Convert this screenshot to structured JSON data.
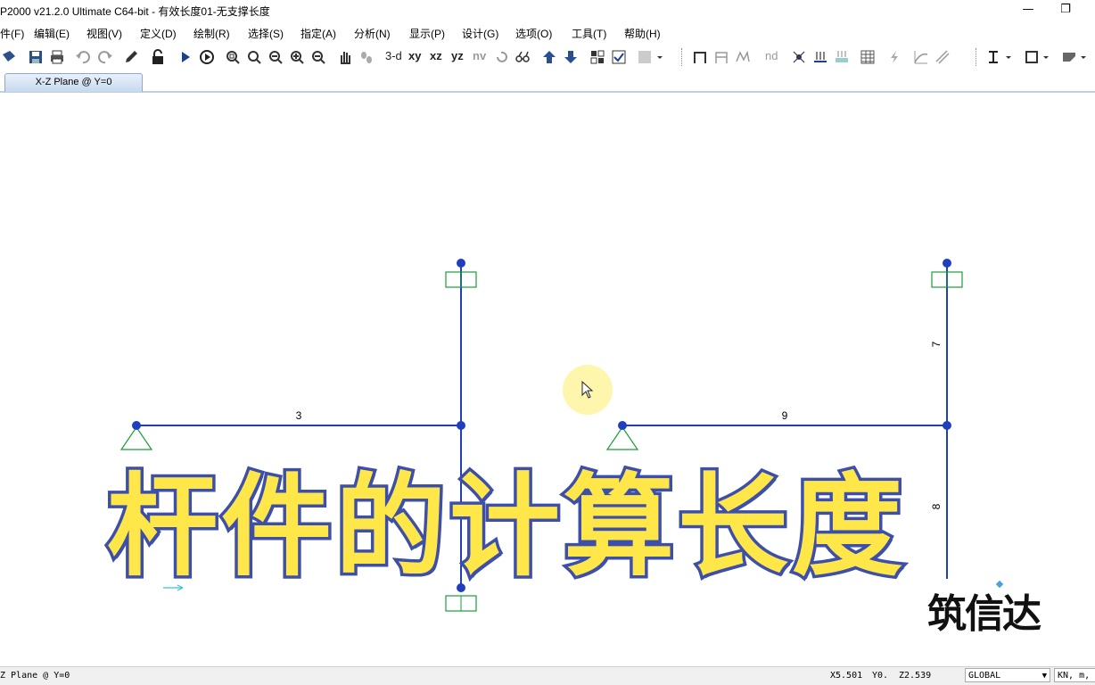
{
  "window": {
    "title": "P2000 v21.2.0 Ultimate C64-bit - 有效长度01-无支撑长度",
    "minimize_glyph": "—",
    "restore_glyph": "❐"
  },
  "menu": {
    "items": [
      {
        "label": "件(F)"
      },
      {
        "label": "编辑(E)"
      },
      {
        "label": "视图(V)"
      },
      {
        "label": "定义(D)"
      },
      {
        "label": "绘制(R)"
      },
      {
        "label": "选择(S)"
      },
      {
        "label": "指定(A)"
      },
      {
        "label": "分析(N)"
      },
      {
        "label": "显示(P)"
      },
      {
        "label": "设计(G)"
      },
      {
        "label": "选项(O)"
      },
      {
        "label": "工具(T)"
      },
      {
        "label": "帮助(H)"
      }
    ]
  },
  "toolbar": {
    "view_3d": "3-d",
    "view_xy": "xy",
    "view_xz": "xz",
    "view_yz": "yz",
    "view_nv": "nv",
    "nd_label": "nd"
  },
  "tabs": [
    {
      "label": "X-Z Plane @ Y=0",
      "active": true
    }
  ],
  "model": {
    "frame_labels": {
      "left_beam": "3",
      "right_beam": "9",
      "right_col_top": "7",
      "right_col_bottom": "8"
    },
    "frame_color": "#1f3fbf",
    "joint_color": "#1f3fbf",
    "support_color": "#1a9e3a"
  },
  "overlay": {
    "title": "杆件的计算长度",
    "logo": "筑信达",
    "title_fill": "#ffe74a",
    "title_stroke": "#3d4fa8"
  },
  "statusbar": {
    "view_name": "Z Plane @ Y=0",
    "x": "X5.501",
    "y": "Y0.",
    "z": "Z2.539",
    "coord_system": "GLOBAL",
    "units": "KN, m,"
  }
}
